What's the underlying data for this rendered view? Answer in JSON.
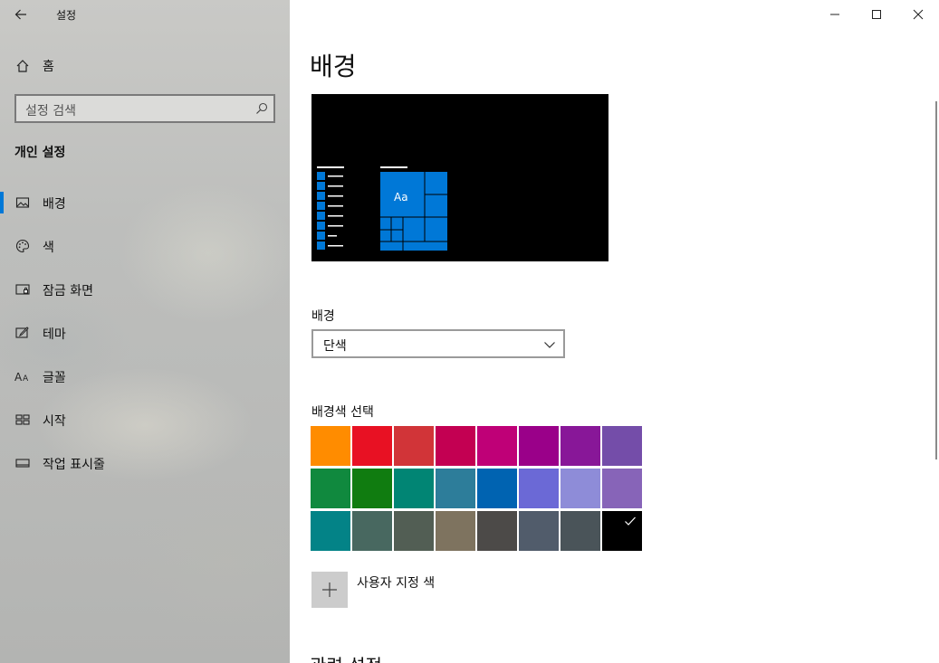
{
  "window": {
    "title": "설정"
  },
  "sidebar": {
    "home_label": "홈",
    "search_placeholder": "설정 검색",
    "section_title": "개인 설정",
    "items": [
      {
        "label": "배경",
        "icon": "picture-icon",
        "active": true
      },
      {
        "label": "색",
        "icon": "palette-icon",
        "active": false
      },
      {
        "label": "잠금 화면",
        "icon": "lock-screen-icon",
        "active": false
      },
      {
        "label": "테마",
        "icon": "theme-brush-icon",
        "active": false
      },
      {
        "label": "글꼴",
        "icon": "font-icon",
        "active": false
      },
      {
        "label": "시작",
        "icon": "start-icon",
        "active": false
      },
      {
        "label": "작업 표시줄",
        "icon": "taskbar-icon",
        "active": false
      }
    ]
  },
  "main": {
    "page_title": "배경",
    "preview": {
      "tile_text": "Aa",
      "accent": "#0078d7",
      "background": "#000000"
    },
    "background_label": "배경",
    "background_value": "단색",
    "colors_label": "배경색 선택",
    "colors": [
      [
        "#ff8c00",
        "#e81123",
        "#d13438",
        "#c30052",
        "#bf0077",
        "#9a0089",
        "#881798",
        "#744da9"
      ],
      [
        "#10893e",
        "#107c10",
        "#018574",
        "#2d7d9a",
        "#0063b1",
        "#6b69d6",
        "#8e8cd8",
        "#8764b8"
      ],
      [
        "#038387",
        "#486860",
        "#525e54",
        "#7e735f",
        "#4c4a48",
        "#515c6b",
        "#4a5459",
        "#000000"
      ]
    ],
    "selected_color": "#000000",
    "custom_color_label": "사용자 지정 색",
    "related_settings_label": "관련 설정"
  }
}
